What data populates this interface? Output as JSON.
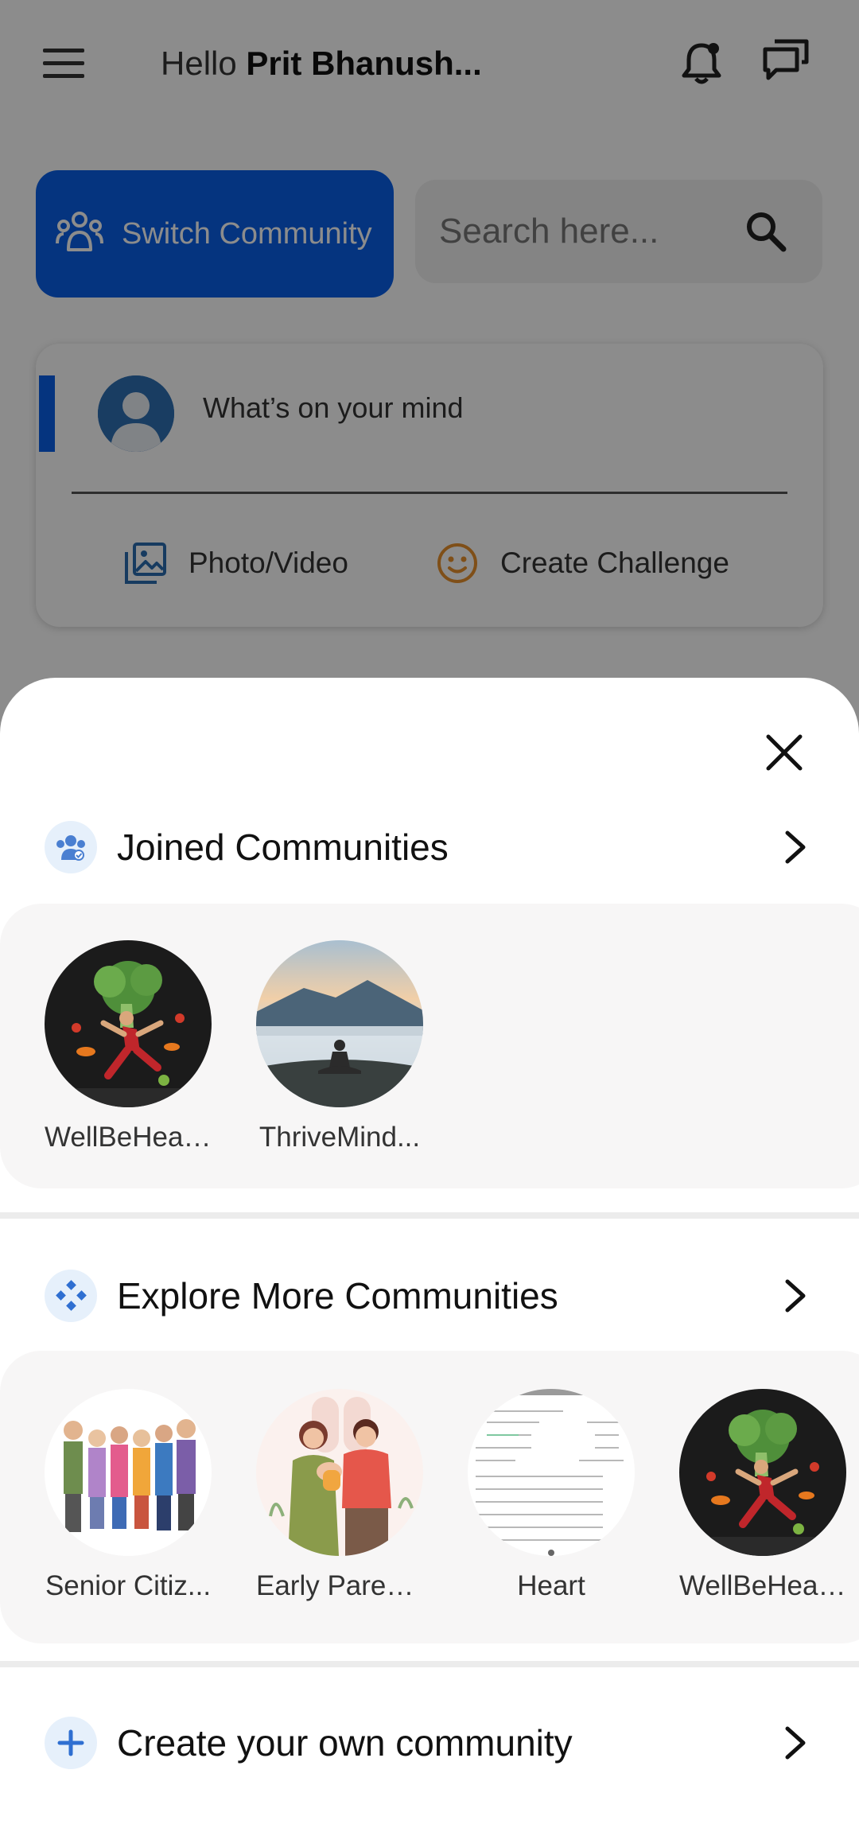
{
  "header": {
    "greeting_prefix": "Hello",
    "user_name": "Prit Bhanush..."
  },
  "community_bar": {
    "switch_label": "Switch Community",
    "search_placeholder": "Search here..."
  },
  "composer": {
    "prompt": "What’s on your mind",
    "photo_video_label": "Photo/Video",
    "create_challenge_label": "Create Challenge"
  },
  "sheet": {
    "joined": {
      "title": "Joined Communities",
      "items": [
        {
          "name": "WellBeHeal...",
          "image": "vegetable-runner-image"
        },
        {
          "name": "ThriveMind...",
          "image": "mountain-meditation-image"
        }
      ]
    },
    "explore": {
      "title": "Explore More Communities",
      "items": [
        {
          "name": "Senior Citiz...",
          "image": "seniors-group-image"
        },
        {
          "name": "Early Paren...",
          "image": "young-parents-image"
        },
        {
          "name": "Heart",
          "image": "document-screenshot-image"
        },
        {
          "name": "WellBeHeal...",
          "image": "vegetable-runner-image"
        }
      ]
    },
    "create": {
      "title": "Create your own community"
    }
  },
  "colors": {
    "primary": "#0a5fe8",
    "strip_bg": "#f7f6f6",
    "icon_badge_bg": "#e6f0fb",
    "challenge_icon": "#e8912d",
    "overlay": "rgba(0,0,0,0.45)"
  }
}
